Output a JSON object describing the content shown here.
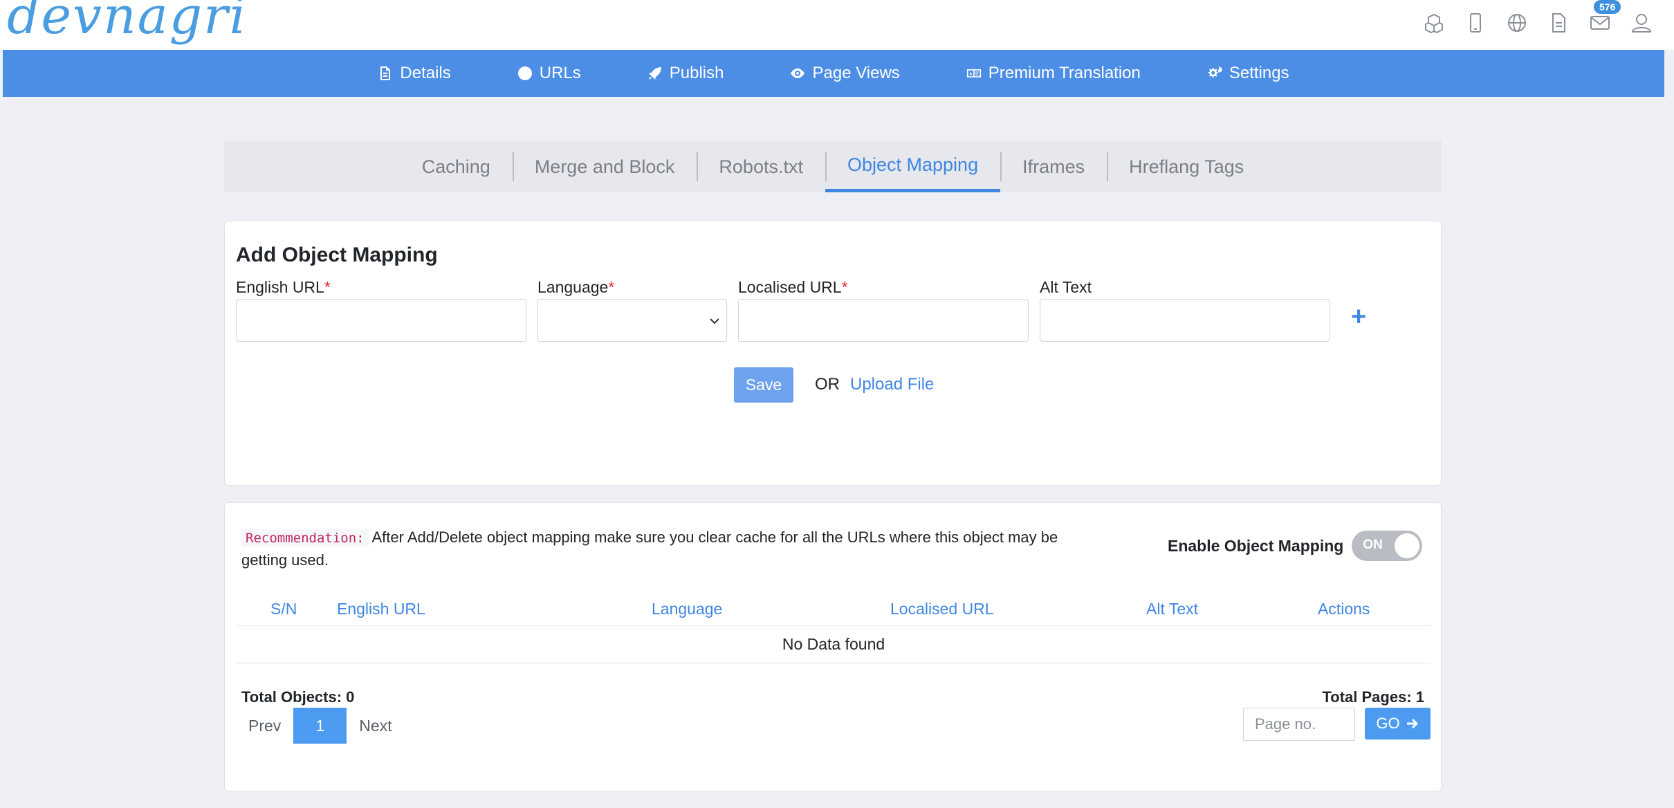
{
  "header": {
    "logo_text": "devnagri",
    "icons": [
      "cubes-icon",
      "mobile-icon",
      "globe-icon",
      "document-icon",
      "mail-icon",
      "user-icon"
    ],
    "mail_badge": "576"
  },
  "nav": {
    "items": [
      {
        "label": "Details",
        "icon": "file-icon"
      },
      {
        "label": "URLs",
        "icon": "globe-icon"
      },
      {
        "label": "Publish",
        "icon": "rocket-icon"
      },
      {
        "label": "Page Views",
        "icon": "eye-icon"
      },
      {
        "label": "Premium Translation",
        "icon": "language-icon"
      },
      {
        "label": "Settings",
        "icon": "gears-icon"
      }
    ]
  },
  "tabs": {
    "items": [
      "Caching",
      "Merge and Block",
      "Robots.txt",
      "Object Mapping",
      "Iframes",
      "Hreflang Tags"
    ],
    "active": "Object Mapping"
  },
  "form": {
    "title": "Add Object Mapping",
    "english_url_label": "English URL",
    "language_label": "Language",
    "localised_url_label": "Localised URL",
    "alt_text_label": "Alt Text",
    "required_mark": "*",
    "add_symbol": "+",
    "save_label": "Save",
    "or_label": "OR",
    "upload_label": "Upload File"
  },
  "list": {
    "recommendation_tag": "Recommendation:",
    "recommendation_text": "After Add/Delete object mapping make sure you clear cache for all the URLs where this object may be getting used.",
    "toggle_label": "Enable Object Mapping",
    "toggle_state": "ON",
    "columns": [
      "S/N",
      "English URL",
      "Language",
      "Localised URL",
      "Alt Text",
      "Actions"
    ],
    "empty_text": "No Data found",
    "total_objects": "Total Objects: 0",
    "total_pages": "Total Pages: 1",
    "prev_label": "Prev",
    "current_page": "1",
    "next_label": "Next",
    "page_placeholder": "Page no.",
    "go_label": "GO"
  }
}
